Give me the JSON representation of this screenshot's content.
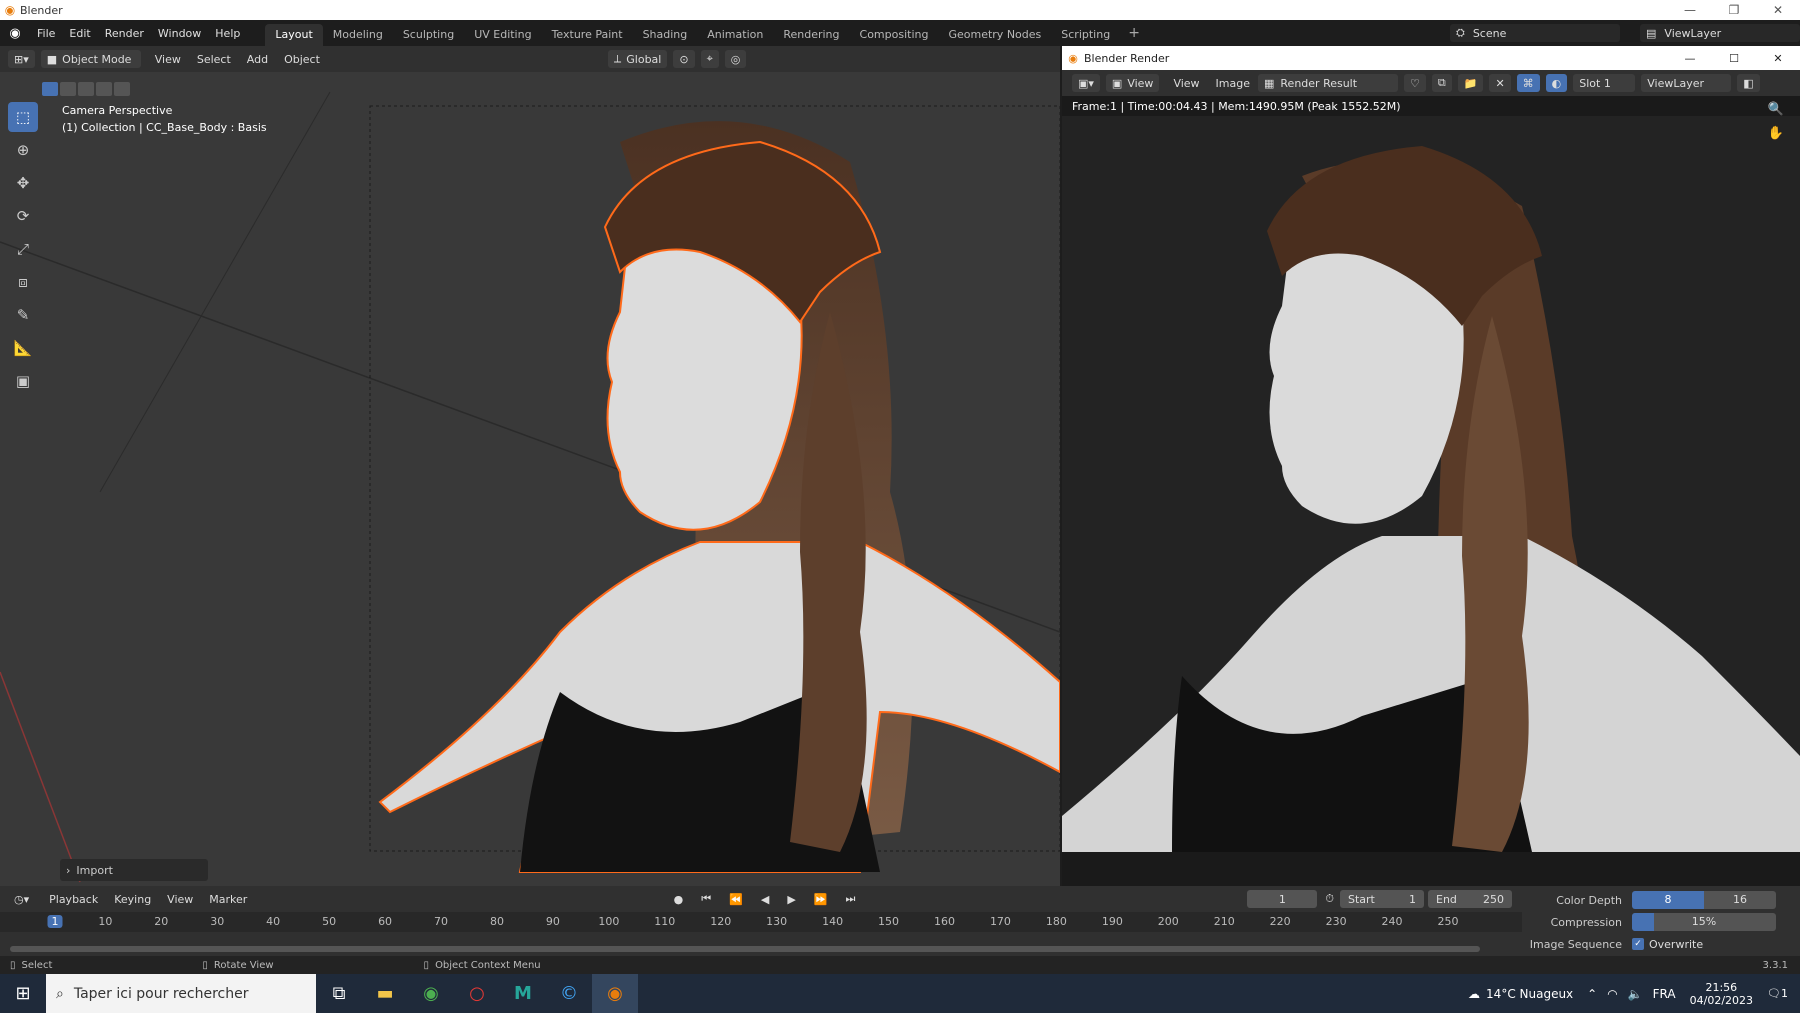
{
  "os_window": {
    "title": "Blender"
  },
  "menu": [
    "File",
    "Edit",
    "Render",
    "Window",
    "Help"
  ],
  "workspaces": [
    "Layout",
    "Modeling",
    "Sculpting",
    "UV Editing",
    "Texture Paint",
    "Shading",
    "Animation",
    "Rendering",
    "Compositing",
    "Geometry Nodes",
    "Scripting"
  ],
  "active_workspace": "Layout",
  "scene": {
    "label": "Scene",
    "view_layer": "ViewLayer"
  },
  "viewport": {
    "mode": "Object Mode",
    "menus": [
      "View",
      "Select",
      "Add",
      "Object"
    ],
    "orientation": "Global",
    "camera_label": "Camera Perspective",
    "collection_label": "(1) Collection | CC_Base_Body : Basis",
    "import_panel": "Import"
  },
  "render_window": {
    "title": "Blender Render",
    "view": "View",
    "menus": [
      "View",
      "Image"
    ],
    "image_name": "Render Result",
    "slot": "Slot 1",
    "view_layer": "ViewLayer",
    "stats": "Frame:1 | Time:00:04.43 | Mem:1490.95M (Peak 1552.52M)"
  },
  "timeline": {
    "menus": [
      "Playback",
      "Keying",
      "View",
      "Marker"
    ],
    "current_frame": "1",
    "start_label": "Start",
    "start": "1",
    "end_label": "End",
    "end": "250",
    "ruler": [
      "1",
      "10",
      "20",
      "30",
      "40",
      "50",
      "60",
      "70",
      "80",
      "90",
      "100",
      "110",
      "120",
      "130",
      "140",
      "150",
      "160",
      "170",
      "180",
      "190",
      "200",
      "210",
      "220",
      "230",
      "240",
      "250"
    ]
  },
  "properties": {
    "color_depth_label": "Color Depth",
    "color_depth_a": "8",
    "color_depth_b": "16",
    "compression_label": "Compression",
    "compression": "15%",
    "compression_fraction": 0.15,
    "image_sequence_label": "Image Sequence",
    "overwrite_label": "Overwrite"
  },
  "statusbar": {
    "select": "Select",
    "rotate": "Rotate View",
    "context": "Object Context Menu",
    "version": "3.3.1"
  },
  "taskbar": {
    "search_placeholder": "Taper ici pour rechercher",
    "weather": "14°C Nuageux",
    "lang": "FRA",
    "time": "21:56",
    "date": "04/02/2023",
    "notifications": "1"
  },
  "colors": {
    "accent": "#4772b3",
    "outline": "#ff6a1a",
    "header": "#303030",
    "background": "#393939"
  }
}
